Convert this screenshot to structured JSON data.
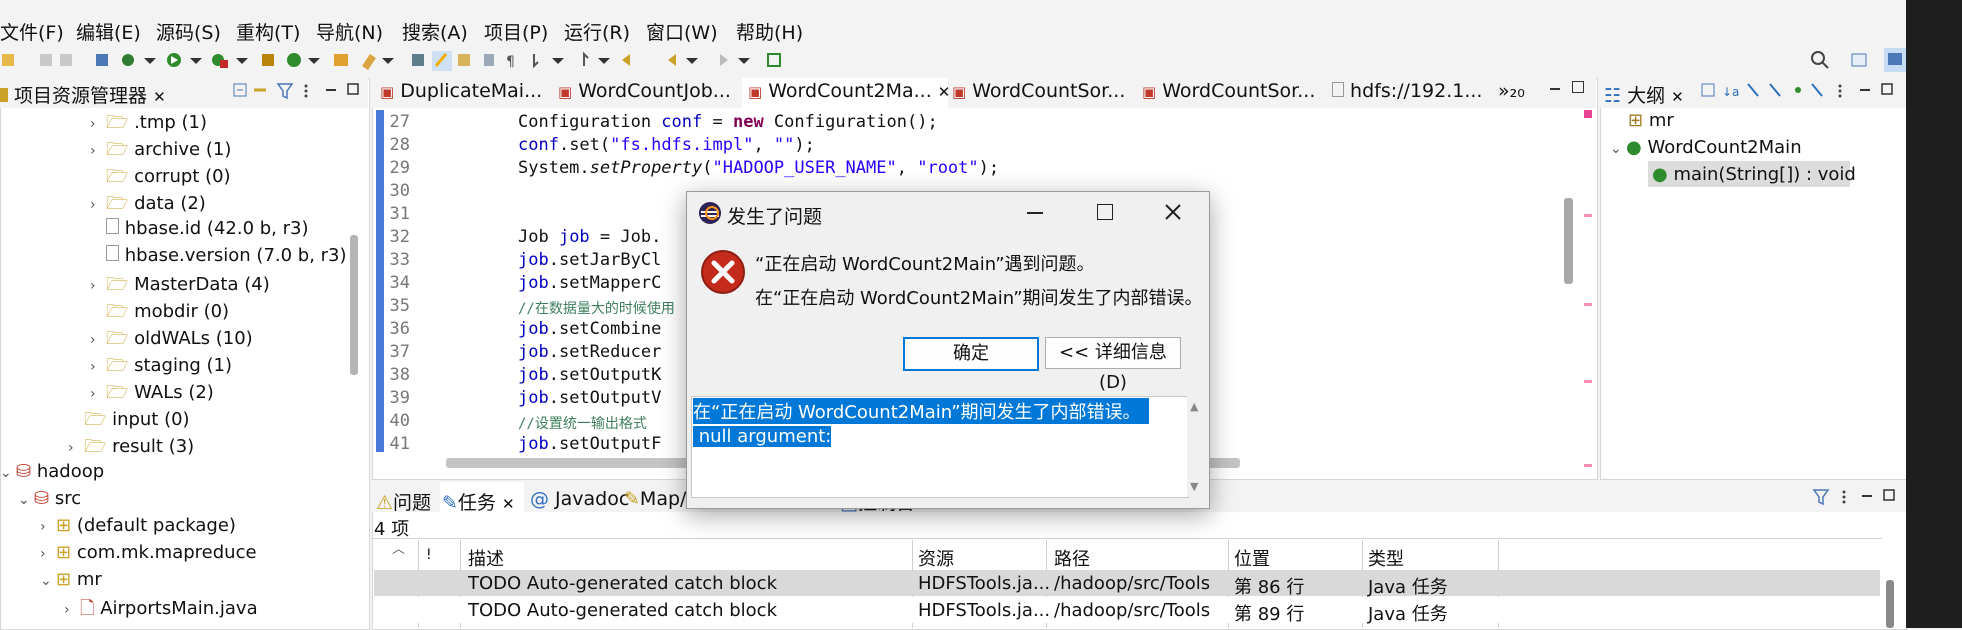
{
  "menu": [
    "文件(F)",
    "编辑(E)",
    "源码(S)",
    "重构(T)",
    "导航(N)",
    "搜索(A)",
    "项目(P)",
    "运行(R)",
    "窗口(W)",
    "帮助(H)"
  ],
  "explorer": {
    "title": "项目资源管理器",
    "items": [
      {
        "label": ".tmp (1)"
      },
      {
        "label": "archive (1)"
      },
      {
        "label": "corrupt (0)"
      },
      {
        "label": "data (2)"
      },
      {
        "label": "hbase.id (42.0 b, r3)"
      },
      {
        "label": "hbase.version (7.0 b, r3)"
      },
      {
        "label": "MasterData (4)"
      },
      {
        "label": "mobdir (0)"
      },
      {
        "label": "oldWALs (10)"
      },
      {
        "label": "staging (1)"
      },
      {
        "label": "WALs (2)"
      },
      {
        "label": "input (0)"
      },
      {
        "label": "result (3)"
      },
      {
        "label": "hadoop"
      },
      {
        "label": "src"
      },
      {
        "label": "(default package)"
      },
      {
        "label": "com.mk.mapreduce"
      },
      {
        "label": "mr"
      },
      {
        "label": "AirportsMain.java"
      }
    ]
  },
  "editor_tabs": [
    "DuplicateMai...",
    "WordCountJob...",
    "WordCount2Ma...",
    "WordCountSor...",
    "WordCountSor...",
    "hdfs://192.1..."
  ],
  "editor_overflow": "»₂₀",
  "code": {
    "lines": [
      "27",
      "28",
      "29",
      "30",
      "31",
      "32",
      "33",
      "34",
      "35",
      "36",
      "37",
      "38",
      "39",
      "40",
      "41"
    ],
    "l27a": "Configuration ",
    "l27b": "conf",
    "l27c": " = ",
    "l27d": "new",
    "l27e": " Configuration();",
    "l28a": "conf",
    "l28b": ".set(",
    "l28c": "\"fs.hdfs.impl\"",
    "l28d": ", ",
    "l28e": "\"\"",
    "l28f": ");",
    "l29a": "System.",
    "l29b": "setProperty",
    "l29c": "(",
    "l29d": "\"HADOOP_USER_NAME\"",
    "l29e": ", ",
    "l29f": "\"root\"",
    "l29g": ");",
    "l32a": "Job ",
    "l32b": "job",
    "l32c": " = Job.",
    "l33a": "job",
    "l33b": ".setJarByCl",
    "l34a": "job",
    "l34b": ".setMapperC",
    "l35": "//在数据量大的时候使用",
    "l36a": "job",
    "l36b": ".setCombine",
    "l37a": "job",
    "l37b": ".setReducer",
    "l38a": "job",
    "l38b": ".setOutputK",
    "l39a": "job",
    "l39b": ".setOutputV",
    "l40": "//设置统一输出格式",
    "l41a": "job",
    "l41b": ".setOutputF"
  },
  "outline": {
    "title": "大纲",
    "items": [
      "mr",
      "WordCount2Main",
      "main(String[]) : void"
    ]
  },
  "bottom": {
    "tabs": [
      "问题",
      "任务",
      "Javadoc",
      "Map/Reduce Locations",
      "控制台"
    ],
    "count": "4 项",
    "headers": [
      "描述",
      "资源",
      "路径",
      "位置",
      "类型"
    ],
    "rows": [
      [
        "TODO Auto-generated catch block",
        "HDFSTools.ja...",
        "/hadoop/src/Tools",
        "第 86 行",
        "Java 任务"
      ],
      [
        "TODO Auto-generated catch block",
        "HDFSTools.ja...",
        "/hadoop/src/Tools",
        "第 89 行",
        "Java 任务"
      ]
    ]
  },
  "dialog": {
    "title": "发生了问题",
    "message1": "“正在启动 WordCount2Main”遇到问题。",
    "message2": "在“正在启动 WordCount2Main”期间发生了内部错误。",
    "ok": "确定",
    "details": "<< 详细信息(D)",
    "detail_line1": "在“正在启动 WordCount2Main”期间发生了内部错误。",
    "detail_line2": " null argument:"
  },
  "colors": {
    "accent": "#0078d7",
    "selection": "#0078d7",
    "error_red": "#c42b1c"
  }
}
